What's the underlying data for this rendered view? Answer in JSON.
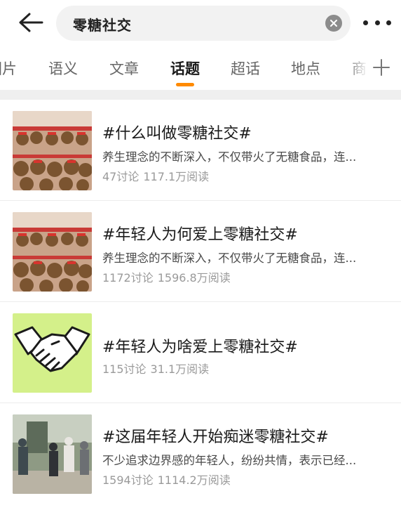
{
  "search": {
    "query": "零糖社交",
    "back_icon": "back-arrow-icon",
    "clear_icon": "clear-icon",
    "more_icon": "more-dots-icon"
  },
  "tabs": [
    {
      "label": "图片"
    },
    {
      "label": "语义"
    },
    {
      "label": "文章"
    },
    {
      "label": "话题",
      "active": true
    },
    {
      "label": "超话"
    },
    {
      "label": "地点"
    },
    {
      "label": "商"
    }
  ],
  "tab_add_icon": "plus-icon",
  "accent_color": "#ff8a00",
  "topics": [
    {
      "title": "#什么叫做零糖社交#",
      "desc": "养生理念的不断深入，不仅带火了无糖食品，连...",
      "discussions": "47讨论",
      "reads": "117.1万阅读",
      "thumb": "plush-toys-display"
    },
    {
      "title": "#年轻人为何爱上零糖社交#",
      "desc": "养生理念的不断深入，不仅带火了无糖食品，连...",
      "discussions": "1172讨论",
      "reads": "1596.8万阅读",
      "thumb": "plush-toys-display"
    },
    {
      "title": "#年轻人为啥爱上零糖社交#",
      "desc": "",
      "discussions": "115讨论",
      "reads": "31.1万阅读",
      "thumb": "handshake"
    },
    {
      "title": "#这届年轻人开始痴迷零糖社交#",
      "desc": "不少追求边界感的年轻人，纷纷共情，表示已经...",
      "discussions": "1594讨论",
      "reads": "1114.2万阅读",
      "thumb": "people-outdoors"
    }
  ]
}
